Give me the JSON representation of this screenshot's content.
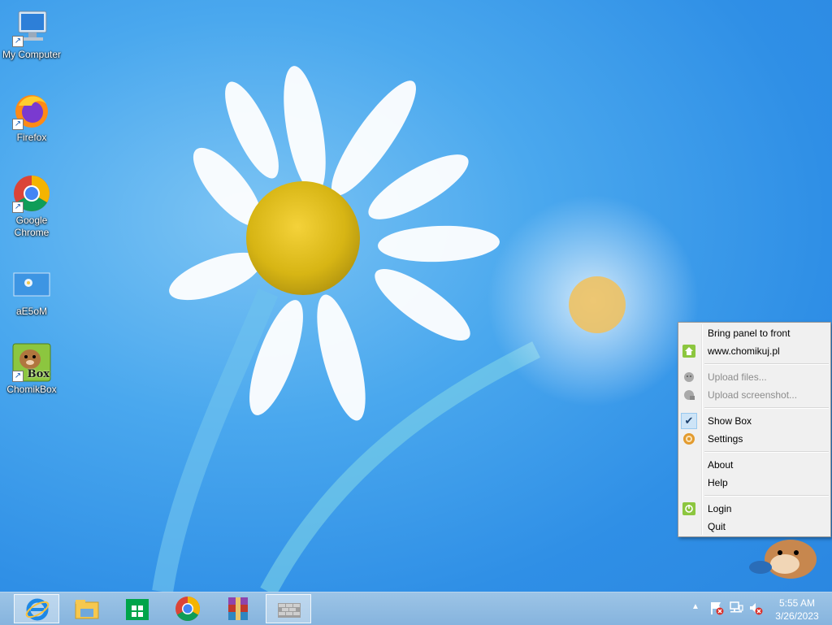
{
  "desktop": {
    "icons": [
      {
        "label": "My Computer",
        "icon": "computer-icon"
      },
      {
        "label": "Firefox",
        "icon": "firefox-icon"
      },
      {
        "label": "Google Chrome",
        "icon": "chrome-icon"
      },
      {
        "label": "aE5oM",
        "icon": "image-file-icon"
      },
      {
        "label": "ChomikBox",
        "icon": "chomikbox-icon",
        "badge": "Box"
      }
    ]
  },
  "context_menu": {
    "items": [
      {
        "label": "Bring panel to front",
        "enabled": true
      },
      {
        "label": "www.chomikuj.pl",
        "enabled": true,
        "icon": "home-icon"
      },
      {
        "label": "Upload files...",
        "enabled": false,
        "icon": "upload-icon"
      },
      {
        "label": "Upload screenshot...",
        "enabled": false,
        "icon": "upload-screenshot-icon"
      },
      {
        "label": "Show Box",
        "enabled": true,
        "checked": true,
        "icon": "checkmark-icon"
      },
      {
        "label": "Settings",
        "enabled": true,
        "icon": "gear-icon"
      },
      {
        "label": "About",
        "enabled": true
      },
      {
        "label": "Help",
        "enabled": true
      },
      {
        "label": "Login",
        "enabled": true,
        "icon": "power-icon"
      },
      {
        "label": "Quit",
        "enabled": true
      }
    ],
    "check_glyph": "✔"
  },
  "taskbar": {
    "apps": [
      {
        "name": "internet-explorer-icon",
        "active": true
      },
      {
        "name": "file-explorer-icon",
        "active": false
      },
      {
        "name": "store-icon",
        "active": false
      },
      {
        "name": "chrome-icon",
        "active": false
      },
      {
        "name": "winrar-icon",
        "active": false
      },
      {
        "name": "chomikbox-wall-icon",
        "active": true
      }
    ],
    "tray": {
      "chevron": "▲",
      "icons": [
        "action-center-flag-icon",
        "network-icon",
        "volume-muted-icon"
      ]
    },
    "clock": {
      "time": "5:55 AM",
      "date": "3/26/2023"
    }
  },
  "colors": {
    "desktop_bg": "#2f8fe6",
    "menu_bg": "#f0f0f0",
    "taskbar_bg": "#8cb9e2",
    "check_bg": "#cde4f7"
  }
}
